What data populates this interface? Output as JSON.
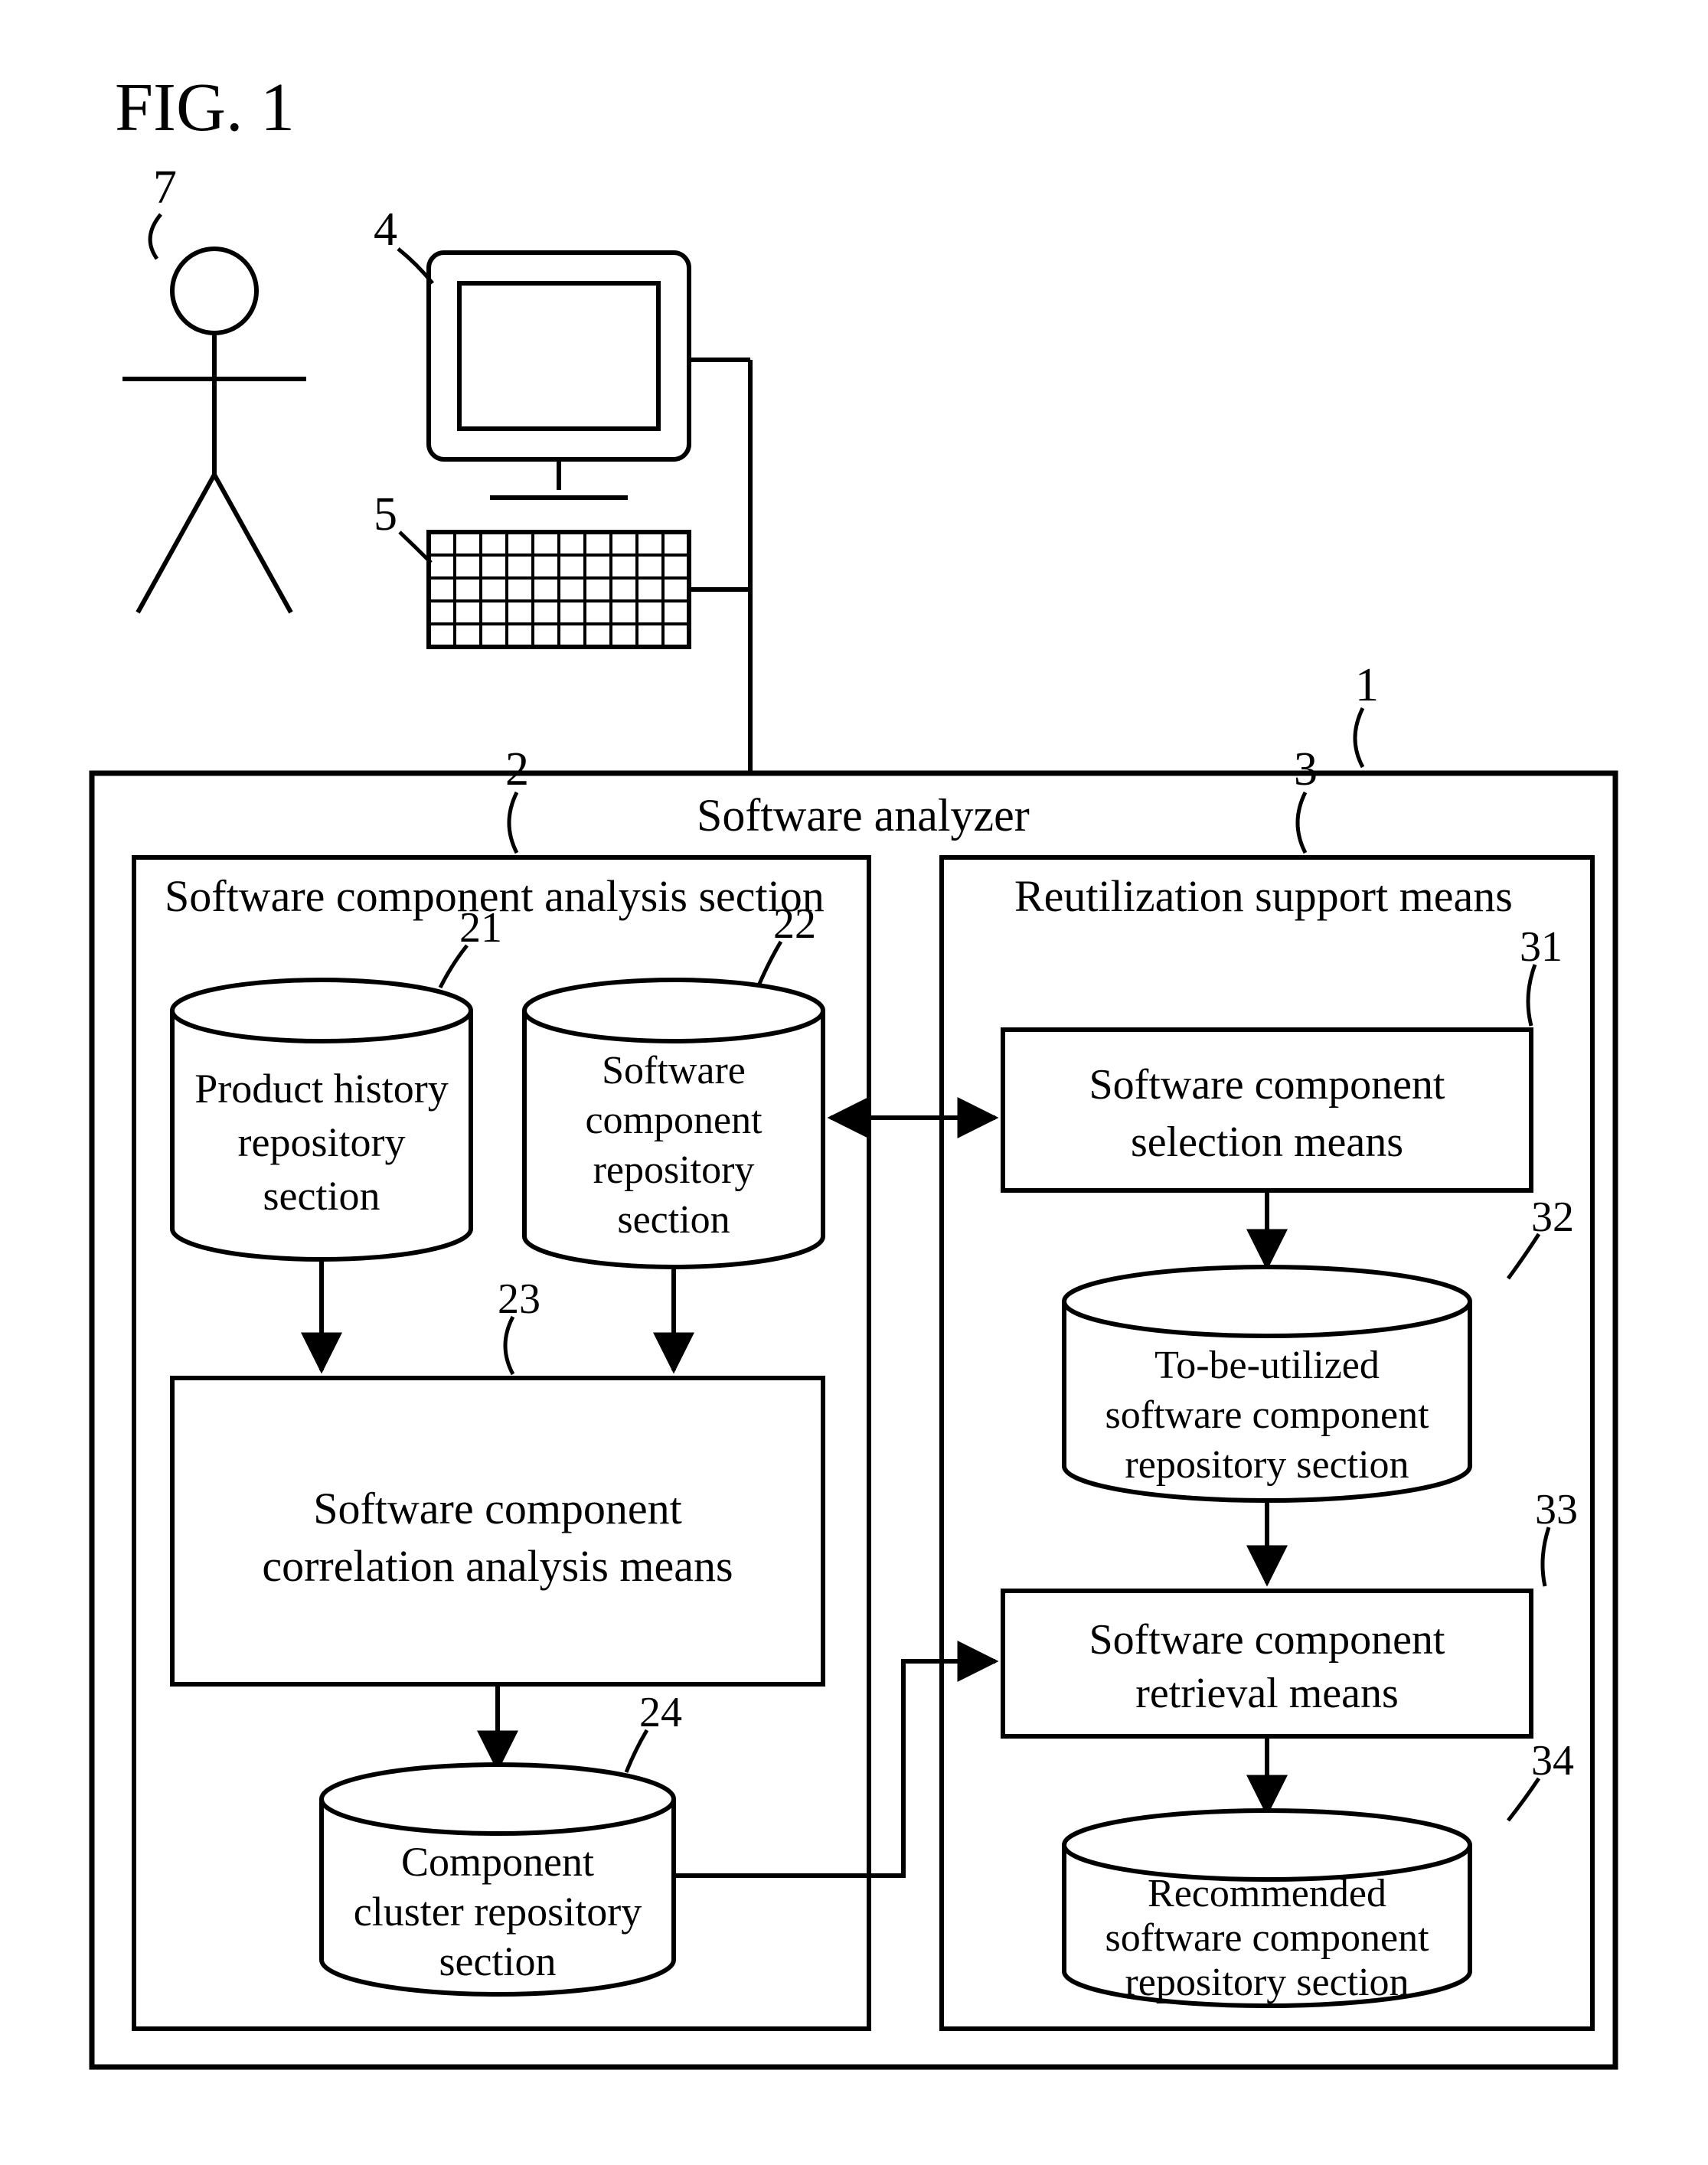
{
  "figure_label": "FIG. 1",
  "refs": {
    "user": "7",
    "monitor": "4",
    "keyboard": "5",
    "analyzer": "1",
    "analysis_section": "2",
    "reuse_section": "3",
    "product_history": "21",
    "sw_component_repo": "22",
    "correlation": "23",
    "cluster_repo": "24",
    "selection": "31",
    "to_be_utilized": "32",
    "retrieval": "33",
    "recommended": "34"
  },
  "labels": {
    "analyzer": "Software analyzer",
    "analysis_section": "Software component analysis section",
    "reuse_section": "Reutilization support means",
    "product_history_1": "Product history",
    "product_history_2": "repository",
    "product_history_3": "section",
    "sw_component_repo_1": "Software",
    "sw_component_repo_2": "component",
    "sw_component_repo_3": "repository",
    "sw_component_repo_4": "section",
    "correlation_1": "Software component",
    "correlation_2": "correlation analysis means",
    "cluster_repo_1": "Component",
    "cluster_repo_2": "cluster repository",
    "cluster_repo_3": "section",
    "selection_1": "Software component",
    "selection_2": "selection means",
    "to_be_utilized_1": "To-be-utilized",
    "to_be_utilized_2": "software component",
    "to_be_utilized_3": "repository section",
    "retrieval_1": "Software component",
    "retrieval_2": "retrieval means",
    "recommended_1": "Recommended",
    "recommended_2": "software component",
    "recommended_3": "repository section"
  }
}
